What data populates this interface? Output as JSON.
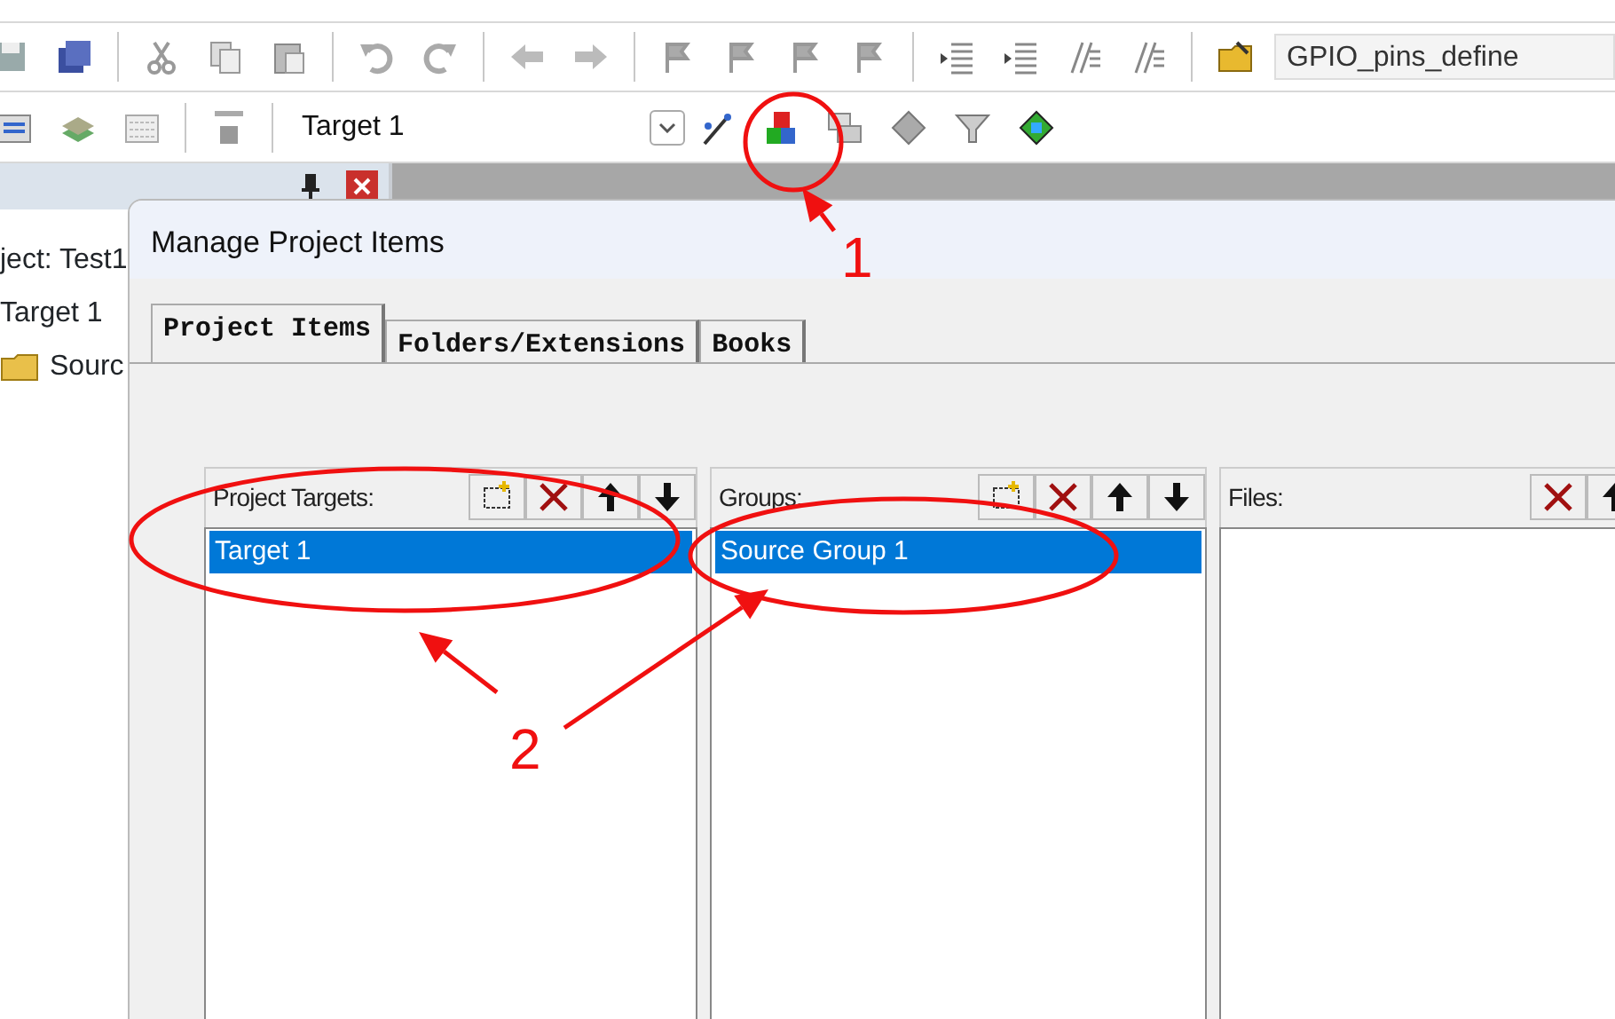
{
  "toolbar": {
    "find_combo": "GPIO_pins_define",
    "target_select": "Target 1"
  },
  "project_panel": {
    "tree": [
      {
        "label": "ject: Test1",
        "children": [
          {
            "label": "Target 1",
            "children": [
              {
                "label": "Sourc"
              }
            ]
          }
        ]
      }
    ]
  },
  "dialog": {
    "title": "Manage Project Items",
    "tabs": [
      {
        "label": "Project Items",
        "selected": true
      },
      {
        "label": "Folders/Extensions",
        "selected": false
      },
      {
        "label": "Books",
        "selected": false
      }
    ],
    "lists": [
      {
        "label": "Project Targets:",
        "buttons": [
          {
            "kind": "new"
          },
          {
            "kind": "delete"
          },
          {
            "kind": "up"
          },
          {
            "kind": "down"
          }
        ],
        "items": [
          {
            "label": "Target 1",
            "selected": true
          }
        ]
      },
      {
        "label": "Groups:",
        "buttons": [
          {
            "kind": "new"
          },
          {
            "kind": "delete"
          },
          {
            "kind": "up"
          },
          {
            "kind": "down"
          }
        ],
        "items": [
          {
            "label": "Source Group 1",
            "selected": true
          }
        ]
      },
      {
        "label": "Files:",
        "buttons": [
          {
            "kind": "delete"
          },
          {
            "kind": "up"
          }
        ]
      }
    ]
  },
  "annotations": [
    {
      "label": "1"
    },
    {
      "label": "2"
    }
  ]
}
